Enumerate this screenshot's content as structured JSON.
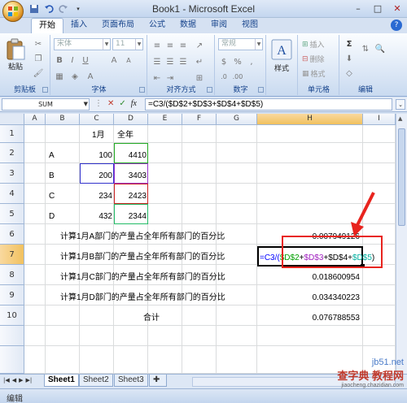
{
  "window": {
    "title": "Book1 - Microsoft Excel",
    "controls": [
      "–",
      "□",
      "✕"
    ]
  },
  "ribbon": {
    "tabs": [
      "开始",
      "插入",
      "页面布局",
      "公式",
      "数据",
      "审阅",
      "视图"
    ],
    "active_tab": "开始",
    "clipboard": {
      "paste_label": "粘贴",
      "group_label": "剪贴板"
    },
    "font": {
      "family_value": "宋体",
      "size_value": "11",
      "group_label": "字体",
      "bold": "B",
      "italic": "I",
      "underline": "U"
    },
    "alignment": {
      "group_label": "对齐方式"
    },
    "number": {
      "format_value": "常规",
      "group_label": "数字"
    },
    "styles": {
      "label": "样式"
    },
    "cells": {
      "insert": "插入",
      "delete": "删除",
      "format": "格式",
      "group_label": "单元格"
    },
    "editing": {
      "sigma": "Σ",
      "group_label": "编辑"
    }
  },
  "formula_bar": {
    "name_box": "SUM",
    "icons": [
      "✓",
      "✕",
      "fx"
    ],
    "formula": "=C3/($D$2+$D$3+$D$4+$D$5)"
  },
  "columns": [
    "A",
    "B",
    "C",
    "D",
    "E",
    "F",
    "G",
    "H",
    "I"
  ],
  "rows": [
    "1",
    "2",
    "3",
    "4",
    "5",
    "6",
    "7",
    "8",
    "9",
    "10"
  ],
  "cells": {
    "C1": "1月",
    "D1": "全年",
    "B2": "A",
    "C2": "100",
    "D2": "4410",
    "B3": "B",
    "C3": "200",
    "D3": "3403",
    "B4": "C",
    "C4": "234",
    "D4": "2423",
    "B5": "D",
    "C5": "432",
    "D5": "2344",
    "C6": "计算1月A部门的产量占全年所有部门的百分比",
    "H6": "0.007949126",
    "C7": "计算1月B部门的产量占全年所有部门的百分比",
    "C8": "计算1月C部门的产量占全年所有部门的百分比",
    "H8": "0.018600954",
    "C9": "计算1月D部门的产量占全年所有部门的百分比",
    "H9": "0.034340223",
    "D10": "合计",
    "H10": "0.076788553"
  },
  "editing_cell": {
    "parts": [
      {
        "text": "=C3/(",
        "color": "#0000ff"
      },
      {
        "text": "$D$2",
        "color": "#00a000"
      },
      {
        "text": "+",
        "color": "#000000"
      },
      {
        "text": "$D$3",
        "color": "#a020c0"
      },
      {
        "text": "+",
        "color": "#000000"
      },
      {
        "text": "$D$4",
        "color": "#000000"
      },
      {
        "text": "+",
        "color": "#000000"
      },
      {
        "text": "$D$5",
        "color": "#00b0a0"
      },
      {
        "text": ")",
        "color": "#000000"
      }
    ]
  },
  "reference_colors": {
    "C3": "#3333cc",
    "D2": "#22aa22",
    "D3": "#9933cc",
    "D4": "#cc2222",
    "D5": "#22bb66"
  },
  "sheets": [
    "Sheet1",
    "Sheet2",
    "Sheet3"
  ],
  "active_sheet": "Sheet1",
  "status": "编辑",
  "watermark": {
    "line1": "jb51.net",
    "line2": "查字典 教程网",
    "line3": "jiaocheng.chazidian.com"
  }
}
